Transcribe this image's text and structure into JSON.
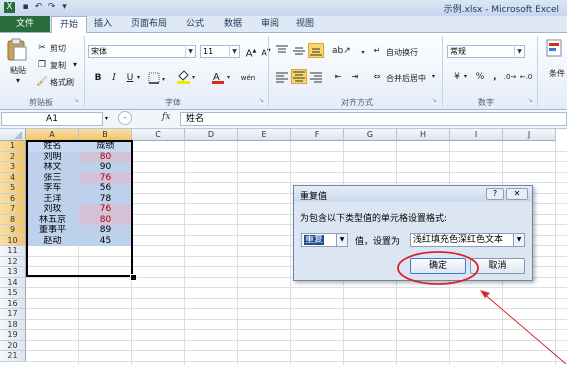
{
  "window": {
    "title": "示例.xlsx - Microsoft Excel"
  },
  "tabs": [
    "文件",
    "开始",
    "插入",
    "页面布局",
    "公式",
    "数据",
    "审阅",
    "视图"
  ],
  "ribbon": {
    "clipboard": {
      "paste": "粘贴",
      "cut": "剪切",
      "copy": "复制",
      "format_painter": "格式刷",
      "label": "剪贴板"
    },
    "font": {
      "name": "宋体",
      "size": "11",
      "bold": "B",
      "italic": "I",
      "underline": "U",
      "increase": "A",
      "decrease": "A",
      "font_color": "A",
      "phonetic": "wén",
      "label": "字体"
    },
    "alignment": {
      "wrap": "自动换行",
      "merge": "合并后居中",
      "label": "对齐方式"
    },
    "number": {
      "format": "常规",
      "percent": "%",
      "comma": ",",
      "label": "数字"
    },
    "styles": {
      "conditional": "条件"
    }
  },
  "formula_bar": {
    "name_box": "A1",
    "fx": "fx",
    "value": "姓名"
  },
  "columns": [
    "A",
    "B",
    "C",
    "D",
    "E",
    "F",
    "G",
    "H",
    "I",
    "J"
  ],
  "rows": [
    "1",
    "2",
    "3",
    "4",
    "5",
    "6",
    "7",
    "8",
    "9",
    "10",
    "11",
    "12",
    "13",
    "14",
    "15",
    "16",
    "17",
    "18",
    "19",
    "20",
    "21"
  ],
  "table": [
    {
      "name": "姓名",
      "score": "成绩"
    },
    {
      "name": "刘明",
      "score": "80"
    },
    {
      "name": "林文",
      "score": "90"
    },
    {
      "name": "张三",
      "score": "76"
    },
    {
      "name": "李车",
      "score": "56"
    },
    {
      "name": "王洋",
      "score": "78"
    },
    {
      "name": "刘玫",
      "score": "76"
    },
    {
      "name": "林五京",
      "score": "80"
    },
    {
      "name": "董事平",
      "score": "89"
    },
    {
      "name": "赵动",
      "score": "45"
    }
  ],
  "highlight_colors": {
    "header": "#c5d9f1",
    "selection": "#bdd1ec",
    "duplicate_fill": "#d7c1d8",
    "duplicate_text": "#9c0006",
    "annotation": "#d8232a"
  },
  "dialog": {
    "title": "重复值",
    "help": "?",
    "close": "✕",
    "prompt": "为包含以下类型值的单元格设置格式:",
    "type_value": "重复",
    "connector": "值，设置为",
    "format_value": "浅红填充色深红色文本",
    "ok": "确定",
    "cancel": "取消"
  }
}
